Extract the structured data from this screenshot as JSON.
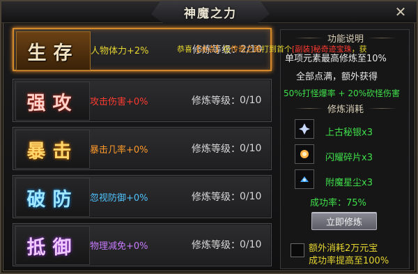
{
  "window": {
    "title": "神魔之力",
    "close_glyph": "✕"
  },
  "ticker": {
    "prefix": "恭喜",
    "player": "【冰点】",
    "mid": "在",
    "place": "传奇之路",
    "action": "打到首个",
    "item": "[副装]秘奇迹宝珠",
    "suffix": "，获"
  },
  "rows": [
    {
      "glyph": "生存",
      "glyph_color": "#f3e3c3",
      "stat": "人物体力+2%",
      "stat_color": "#e5d52f",
      "level_label": "修炼等级：",
      "level": "2/10",
      "active": true
    },
    {
      "glyph": "强攻",
      "glyph_color": "#ffd1c8",
      "stat": "攻击伤害+0%",
      "stat_color": "#ff3b30",
      "level_label": "修炼等级：",
      "level": "0/10",
      "active": false
    },
    {
      "glyph": "暴击",
      "glyph_color": "#ffd66b",
      "stat": "暴击几率+0%",
      "stat_color": "#ff9a2a",
      "level_label": "修炼等级：",
      "level": "0/10",
      "active": false
    },
    {
      "glyph": "破防",
      "glyph_color": "#9fe6ff",
      "stat": "忽视防御+0%",
      "stat_color": "#4fc3ff",
      "level_label": "修炼等级：",
      "level": "0/10",
      "active": false
    },
    {
      "glyph": "抵御",
      "glyph_color": "#f0c9ff",
      "stat": "物理减免+0%",
      "stat_color": "#c87bff",
      "level_label": "修炼等级：",
      "level": "0/10",
      "active": false
    }
  ],
  "right": {
    "func_title": "功能说明",
    "func_line1": "单项元素最高修炼至10%",
    "func_line2": "全部点满，额外获得",
    "func_line3": "50%打怪爆率 + 20%砍怪伤害",
    "cost_title": "修炼消耗",
    "items": [
      {
        "name": "上古秘银x3",
        "icon": "silver-ore-icon",
        "icon_color": "#c9d8ff"
      },
      {
        "name": "闪耀碎片x3",
        "icon": "shining-shard-icon",
        "icon_color": "#ffb347"
      },
      {
        "name": "附魔星尘x3",
        "icon": "star-dust-icon",
        "icon_color": "#46a8ff"
      }
    ],
    "success": "成功率：75%",
    "button": "立即修炼",
    "extra_line1": "额外消耗2万元宝",
    "extra_line2": "成功率提高至100%"
  }
}
